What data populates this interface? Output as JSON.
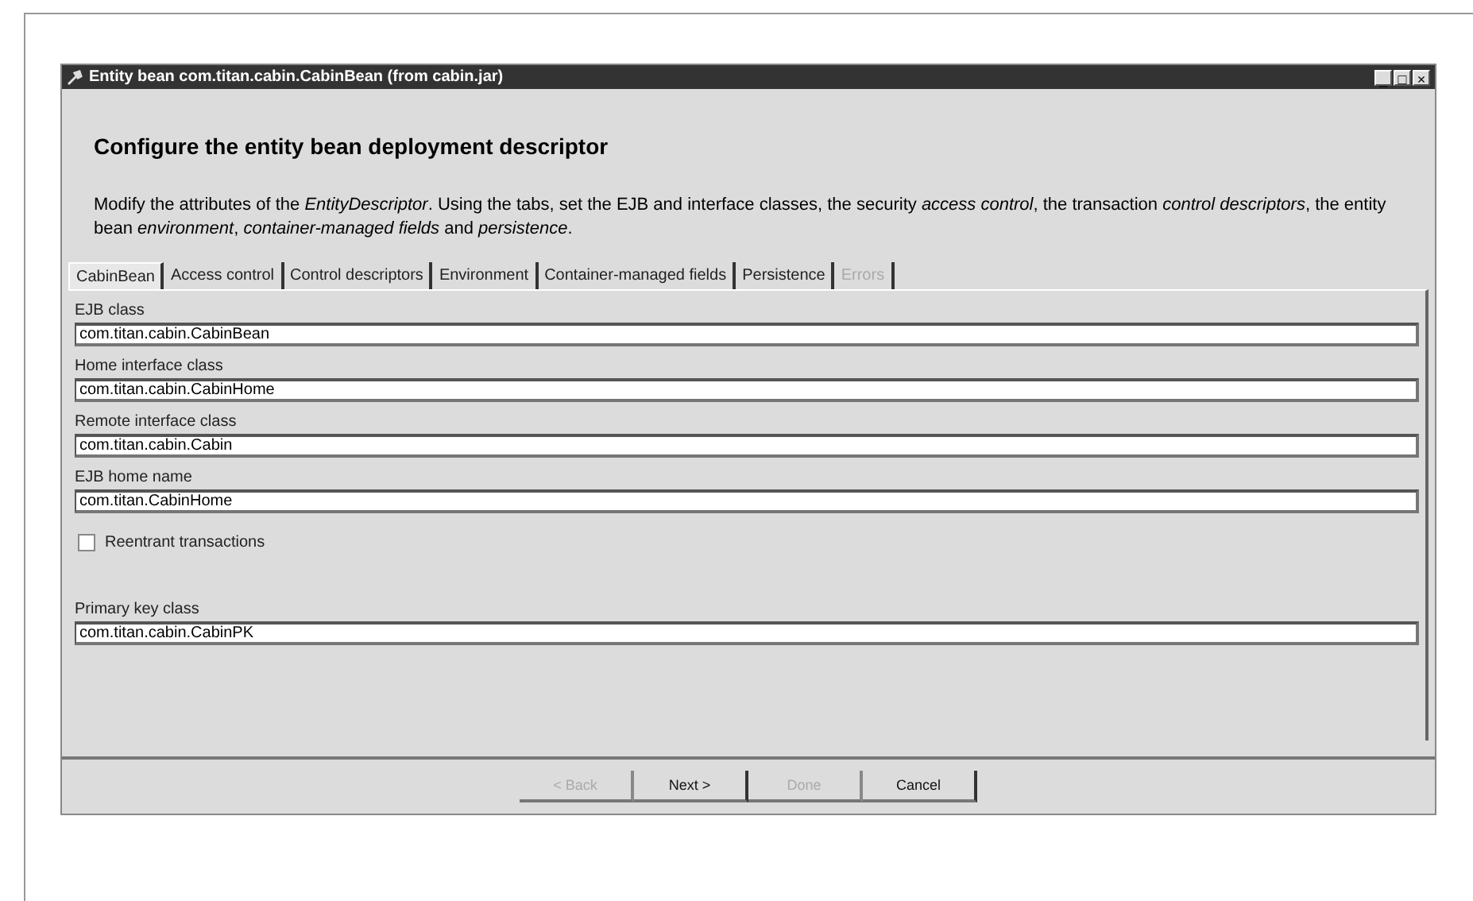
{
  "window": {
    "title": "Entity bean com.titan.cabin.CabinBean (from cabin.jar)",
    "controls": [
      "_",
      "□",
      "×"
    ]
  },
  "heading": "Configure the entity bean deployment descriptor",
  "description": "Modify the attributes of the *EntityDescriptor*. Using the tabs, set the EJB and interface classes, the security *access control*, the transaction *control descriptors*, the entity bean *environment*, *container-managed fields* and *persistence*.",
  "tabs": [
    {
      "label": "CabinBean",
      "selected": true,
      "disabled": false
    },
    {
      "label": "Access control",
      "selected": false,
      "disabled": false
    },
    {
      "label": "Control descriptors",
      "selected": false,
      "disabled": false
    },
    {
      "label": "Environment",
      "selected": false,
      "disabled": false
    },
    {
      "label": "Container-managed fields",
      "selected": false,
      "disabled": false
    },
    {
      "label": "Persistence",
      "selected": false,
      "disabled": false
    },
    {
      "label": "Errors",
      "selected": false,
      "disabled": true
    }
  ],
  "form": [
    {
      "kind": "field",
      "label": "EJB class",
      "value": "com.titan.cabin.CabinBean"
    },
    {
      "kind": "field",
      "label": "Home interface class",
      "value": "com.titan.cabin.CabinHome"
    },
    {
      "kind": "field",
      "label": "Remote interface class",
      "value": "com.titan.cabin.Cabin"
    },
    {
      "kind": "field",
      "label": "EJB home name",
      "value": "com.titan.CabinHome"
    },
    {
      "kind": "checkbox",
      "label": "Reentrant transactions",
      "checked": false
    },
    {
      "kind": "field",
      "label": "Primary key class",
      "value": "com.titan.cabin.CabinPK"
    }
  ],
  "buttons": [
    {
      "label": "< Back",
      "disabled": true
    },
    {
      "label": "Next >",
      "disabled": false
    },
    {
      "label": "Done",
      "disabled": true
    },
    {
      "label": "Cancel",
      "disabled": false
    }
  ]
}
